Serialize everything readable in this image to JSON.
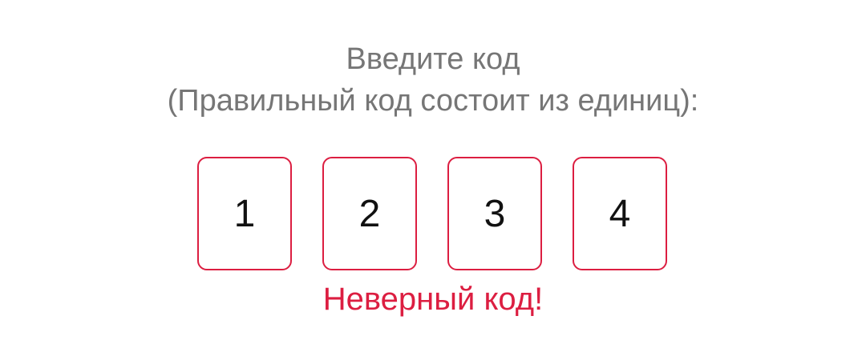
{
  "prompt": {
    "line1": "Введите код",
    "line2": "(Правильный код состоит из единиц):"
  },
  "code": {
    "digits": [
      "1",
      "2",
      "3",
      "4"
    ]
  },
  "error": {
    "message": "Неверный код!"
  },
  "colors": {
    "accent": "#dc1e41",
    "prompt_text": "#767676",
    "digit_text": "#111111",
    "background": "#ffffff"
  }
}
